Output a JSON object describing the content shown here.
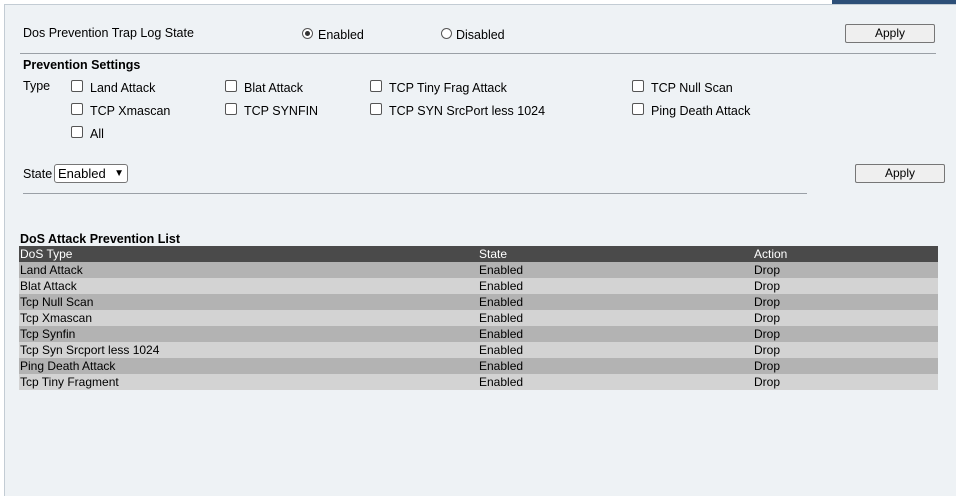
{
  "trap_log": {
    "label": "Dos Prevention Trap Log State",
    "enabled_label": "Enabled",
    "disabled_label": "Disabled",
    "selected": "Enabled",
    "apply_label": "Apply"
  },
  "prevention": {
    "title": "Prevention Settings",
    "type_label": "Type",
    "checkboxes": [
      {
        "label": "Land Attack",
        "checked": false
      },
      {
        "label": "Blat Attack",
        "checked": false
      },
      {
        "label": "TCP Tiny Frag Attack",
        "checked": false
      },
      {
        "label": "TCP Null Scan",
        "checked": false
      },
      {
        "label": "TCP Xmascan",
        "checked": false
      },
      {
        "label": "TCP SYNFIN",
        "checked": false
      },
      {
        "label": "TCP SYN SrcPort less 1024",
        "checked": false
      },
      {
        "label": "Ping Death Attack",
        "checked": false
      },
      {
        "label": "All",
        "checked": false
      }
    ],
    "state_label": "State",
    "state_value": "Enabled",
    "apply_label": "Apply"
  },
  "list": {
    "title": "DoS Attack Prevention List",
    "headers": [
      "DoS Type",
      "State",
      "Action"
    ],
    "rows": [
      [
        "Land Attack",
        "Enabled",
        "Drop"
      ],
      [
        "Blat Attack",
        "Enabled",
        "Drop"
      ],
      [
        "Tcp Null Scan",
        "Enabled",
        "Drop"
      ],
      [
        "Tcp Xmascan",
        "Enabled",
        "Drop"
      ],
      [
        "Tcp Synfin",
        "Enabled",
        "Drop"
      ],
      [
        "Tcp Syn Srcport less 1024",
        "Enabled",
        "Drop"
      ],
      [
        "Ping Death Attack",
        "Enabled",
        "Drop"
      ],
      [
        "Tcp Tiny Fragment",
        "Enabled",
        "Drop"
      ]
    ]
  },
  "colors": {
    "page_bg": "#eef2f5",
    "header_row": "#4a4a4a",
    "row_odd": "#b3b3b3",
    "row_even": "#d3d3d3",
    "top_accent": "#2d4f78"
  }
}
